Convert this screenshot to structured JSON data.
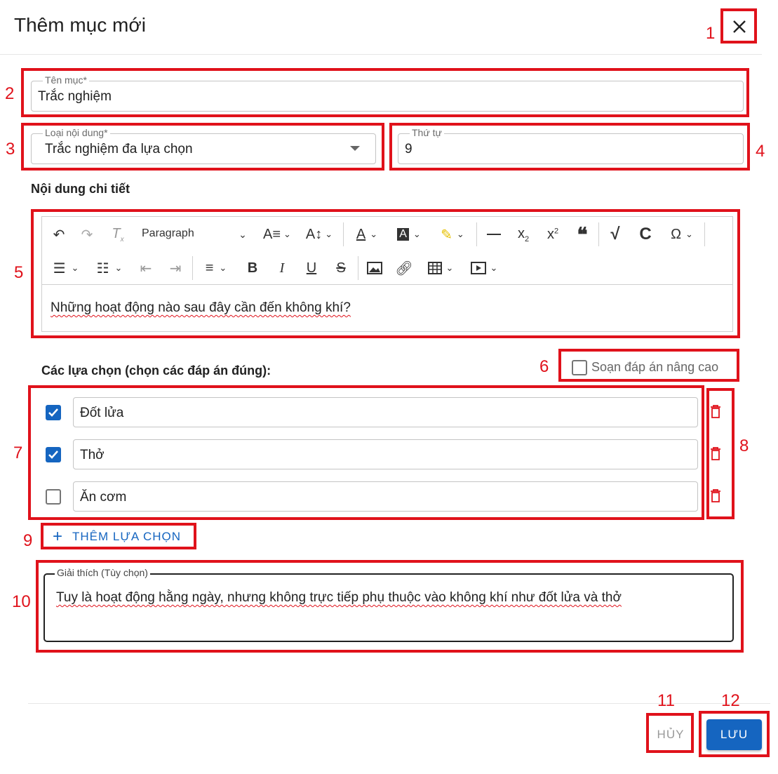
{
  "dialog": {
    "title": "Thêm mục mới"
  },
  "fields": {
    "name": {
      "label": "Tên mục*",
      "value": "Trắc nghiệm"
    },
    "content_type": {
      "label": "Loại nội dung*",
      "value": "Trắc nghiệm đa lựa chọn"
    },
    "order": {
      "label": "Thứ tự",
      "value": "9"
    }
  },
  "detail": {
    "heading": "Nội dung chi tiết",
    "toolbar": {
      "paragraph_label": "Paragraph"
    },
    "content": "Những hoạt động nào sau đây cần đến không khí?"
  },
  "choices": {
    "heading": "Các lựa chọn (chọn các đáp án đúng):",
    "advanced_label": "Soạn đáp án nâng cao",
    "items": [
      {
        "text": "Đốt lửa",
        "checked": true
      },
      {
        "text": "Thở",
        "checked": true
      },
      {
        "text": "Ăn cơm",
        "checked": false
      }
    ],
    "add_label": "THÊM LỰA CHỌN"
  },
  "explanation": {
    "label": "Giải thích (Tùy chọn)",
    "value": "Tuy là hoạt động hằng ngày, nhưng không trực tiếp phụ thuộc vào không khí như đốt lửa và thở"
  },
  "actions": {
    "cancel_label": "HỦY",
    "save_label": "LƯU"
  },
  "annotations": [
    "1",
    "2",
    "3",
    "4",
    "5",
    "6",
    "7",
    "8",
    "9",
    "10",
    "11",
    "12"
  ],
  "colors": {
    "annotation": "#e0121b",
    "primary": "#1565c0"
  }
}
